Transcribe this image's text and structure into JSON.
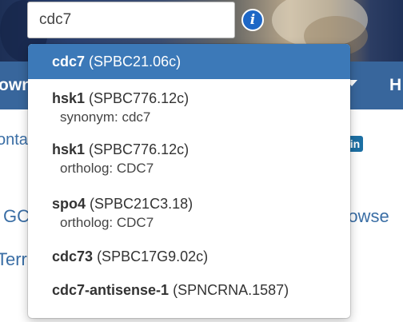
{
  "search": {
    "value": "cdc7"
  },
  "navbar": {
    "left_label": "own",
    "right_label": "H"
  },
  "background": {
    "contact_fragment": "onta",
    "go_fragment": "GC",
    "browse_fragment": "rowse",
    "terms_fragment": "Terr",
    "linkedin_label": "in"
  },
  "suggestions": [
    {
      "name": "cdc7",
      "id": "(SPBC21.06c)",
      "note": ""
    },
    {
      "name": "hsk1",
      "id": "(SPBC776.12c)",
      "note": "synonym: cdc7"
    },
    {
      "name": "hsk1",
      "id": "(SPBC776.12c)",
      "note": "ortholog: CDC7"
    },
    {
      "name": "spo4",
      "id": "(SPBC21C3.18)",
      "note": "ortholog: CDC7"
    },
    {
      "name": "cdc73",
      "id": "(SPBC17G9.02c)",
      "note": ""
    },
    {
      "name": "cdc7-antisense-1",
      "id": "(SPNCRNA.1587)",
      "note": ""
    }
  ],
  "colors": {
    "highlight": "#3c79b8",
    "navbar": "#38669c",
    "info_icon": "#1e67c6"
  }
}
